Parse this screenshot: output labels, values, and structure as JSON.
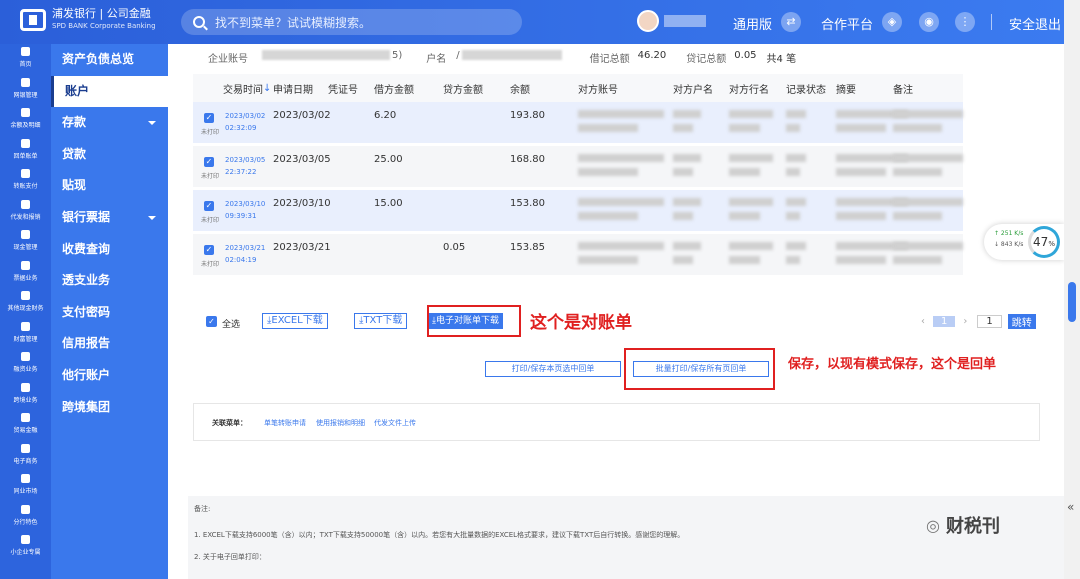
{
  "brand": {
    "name": "浦发银行",
    "name_en": "SPD BANK",
    "division": "公司金融",
    "division_en": "Corporate Banking"
  },
  "topbar": {
    "search_placeholder": "找不到菜单？试试模糊搜索。",
    "version": "通用版",
    "platform": "合作平台",
    "logout": "安全退出"
  },
  "rail": [
    {
      "label": "首页",
      "icon": "home-icon"
    },
    {
      "label": "网银管理",
      "icon": "monitor-icon"
    },
    {
      "label": "余额及明细",
      "icon": "doc-icon"
    },
    {
      "label": "回单账单",
      "icon": "receipt-icon"
    },
    {
      "label": "转账支付",
      "icon": "card-icon"
    },
    {
      "label": "代发和报销",
      "icon": "lock-icon"
    },
    {
      "label": "现金管理",
      "icon": "cash-icon"
    },
    {
      "label": "票据业务",
      "icon": "bill-icon"
    },
    {
      "label": "其他现金财务",
      "icon": "grid-icon"
    },
    {
      "label": "财富管理",
      "icon": "chart-icon"
    },
    {
      "label": "融资业务",
      "icon": "building-icon"
    },
    {
      "label": "跨境业务",
      "icon": "globe-icon"
    },
    {
      "label": "贸易金融",
      "icon": "trade-icon"
    },
    {
      "label": "电子商务",
      "icon": "cart-icon"
    },
    {
      "label": "同业市场",
      "icon": "heart-icon"
    },
    {
      "label": "分行特色",
      "icon": "star-icon"
    },
    {
      "label": "小企业专属",
      "icon": "user-icon"
    }
  ],
  "menu": [
    {
      "label": "资产负债总览",
      "active": false,
      "arrow": false
    },
    {
      "label": "账户",
      "active": true,
      "arrow": false
    },
    {
      "label": "存款",
      "active": false,
      "arrow": true
    },
    {
      "label": "贷款",
      "active": false,
      "arrow": false
    },
    {
      "label": "贴现",
      "active": false,
      "arrow": false
    },
    {
      "label": "银行票据",
      "active": false,
      "arrow": true
    },
    {
      "label": "收费查询",
      "active": false,
      "arrow": false
    },
    {
      "label": "透支业务",
      "active": false,
      "arrow": false
    },
    {
      "label": "支付密码",
      "active": false,
      "arrow": false
    },
    {
      "label": "信用报告",
      "active": false,
      "arrow": false
    },
    {
      "label": "他行账户",
      "active": false,
      "arrow": false
    },
    {
      "label": "跨境集团",
      "active": false,
      "arrow": false
    }
  ],
  "summary": {
    "account_label": "企业账号",
    "account_tail": "5)",
    "name_label": "户名",
    "name_value": "/",
    "debit_label": "借记总额",
    "debit_value": "46.20",
    "credit_label": "贷记总额",
    "credit_value": "0.05",
    "count": "共4 笔"
  },
  "table": {
    "headers": [
      "交易时间",
      "申请日期",
      "凭证号",
      "借方金额",
      "贷方金额",
      "余额",
      "对方账号",
      "对方户名",
      "对方行名",
      "记录状态",
      "摘要",
      "备注"
    ],
    "sort_arrow": "↓",
    "rows": [
      {
        "time_date": "2023/03/02",
        "time_clock": "02:32:09",
        "status": "未打印",
        "apply_date": "2023/03/02",
        "debit": "6.20",
        "credit": "",
        "balance": "193.80",
        "selected": true
      },
      {
        "time_date": "2023/03/05",
        "time_clock": "22:37:22",
        "status": "未打印",
        "apply_date": "2023/03/05",
        "debit": "25.00",
        "credit": "",
        "balance": "168.80",
        "selected": false
      },
      {
        "time_date": "2023/03/10",
        "time_clock": "09:39:31",
        "status": "未打印",
        "apply_date": "2023/03/10",
        "debit": "15.00",
        "credit": "",
        "balance": "153.80",
        "selected": true
      },
      {
        "time_date": "2023/03/21",
        "time_clock": "02:04:19",
        "status": "未打印",
        "apply_date": "2023/03/21",
        "debit": "",
        "credit": "0.05",
        "balance": "153.85",
        "selected": false
      }
    ]
  },
  "actions": {
    "select_all": "全选",
    "excel": "EXCEL下载",
    "txt": "TXT下载",
    "statement": "电子对账单下载",
    "statement_note": "这个是对账单",
    "print_page": "打印/保存本页选中回单",
    "print_all": "批量打印/保存所有页回单",
    "print_note": "保存，以现有模式保存，这个是回单"
  },
  "pager": {
    "page": "1",
    "goto": "1",
    "jump": "跳转"
  },
  "related": {
    "title": "关联菜单：",
    "links": [
      "单笔转账申请",
      "使用报销和明细",
      "代发文件上传"
    ]
  },
  "notes": {
    "title": "备注:",
    "line1": "1. EXCEL下载支持6000笔（含）以内；TXT下载支持50000笔（含）以内。若您有大批量数据的EXCEL格式要求，建议下载TXT后自行转换。感谢您的理解。",
    "line2": "2. 关于电子回单打印："
  },
  "speed_widget": {
    "up": "↑ 251 K/s",
    "down": "↓ 843 K/s",
    "percent": "47",
    "unit": "%"
  },
  "watermark": "财税刊"
}
